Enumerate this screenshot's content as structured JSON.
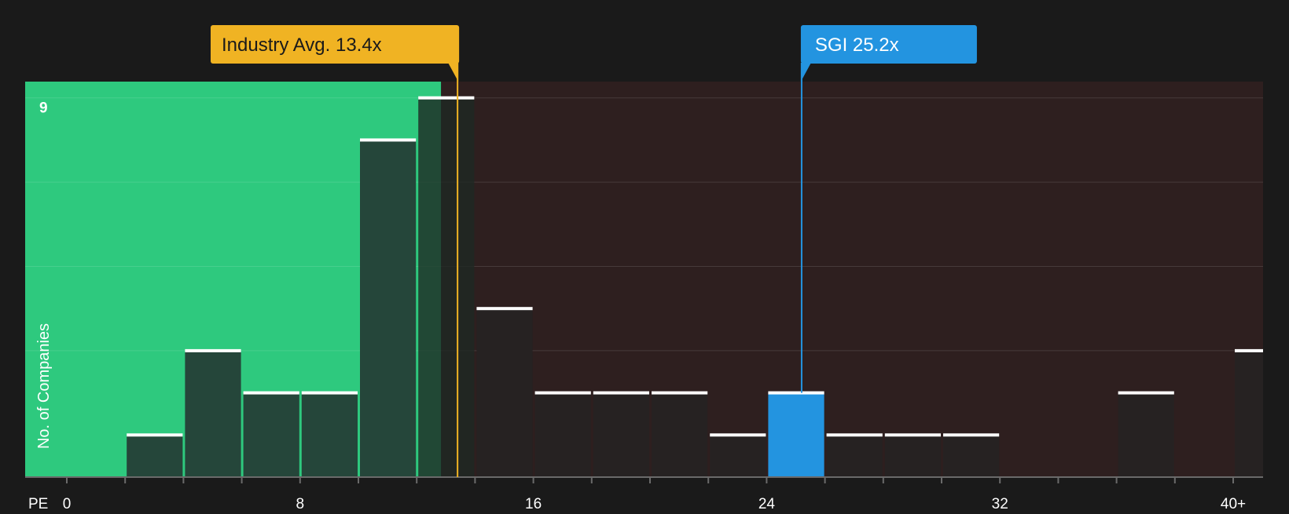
{
  "chart_data": {
    "type": "bar",
    "xlabel": "PE",
    "ylabel": "No. of Companies",
    "x_tick_labels": [
      "0",
      "8",
      "16",
      "24",
      "32",
      "40+"
    ],
    "x_ticks": [
      0,
      8,
      16,
      24,
      32,
      40
    ],
    "y_tick_labels": [
      "9"
    ],
    "y_ticks": [
      9
    ],
    "xlim": [
      -1.4,
      41
    ],
    "ylim": [
      0,
      9.3
    ],
    "bin_width": 2,
    "bins": [
      {
        "start": 2,
        "end": 4,
        "value": 1
      },
      {
        "start": 4,
        "end": 6,
        "value": 3
      },
      {
        "start": 6,
        "end": 8,
        "value": 2
      },
      {
        "start": 8,
        "end": 10,
        "value": 2
      },
      {
        "start": 10,
        "end": 12,
        "value": 8
      },
      {
        "start": 12,
        "end": 14,
        "value": 9
      },
      {
        "start": 14,
        "end": 16,
        "value": 4
      },
      {
        "start": 16,
        "end": 18,
        "value": 2
      },
      {
        "start": 18,
        "end": 20,
        "value": 2
      },
      {
        "start": 20,
        "end": 22,
        "value": 2
      },
      {
        "start": 22,
        "end": 24,
        "value": 1
      },
      {
        "start": 24,
        "end": 26,
        "value": 2,
        "highlight": true
      },
      {
        "start": 26,
        "end": 28,
        "value": 1
      },
      {
        "start": 28,
        "end": 30,
        "value": 1
      },
      {
        "start": 30,
        "end": 32,
        "value": 1
      },
      {
        "start": 36,
        "end": 38,
        "value": 2
      },
      {
        "start": 40,
        "end": 42,
        "value": 3
      }
    ],
    "grid": true,
    "industry_avg": {
      "label": "Industry Avg. 13.4x",
      "value": 13.4
    },
    "company": {
      "label": "SGI 25.2x",
      "value": 25.2
    },
    "colors": {
      "background": "#1a1a1a",
      "good_zone": "#2ec97e",
      "bad_zone": "#2e1f1f",
      "bar_in_good_zone": "#25463a",
      "bar_default": "#262222",
      "bar_highlight": "#2394e0",
      "bar_cap": "#ffffff",
      "industry_avg": "#f0b323",
      "company": "#2394e0",
      "grid": "#4a4040",
      "axis_text": "#ffffff"
    }
  }
}
